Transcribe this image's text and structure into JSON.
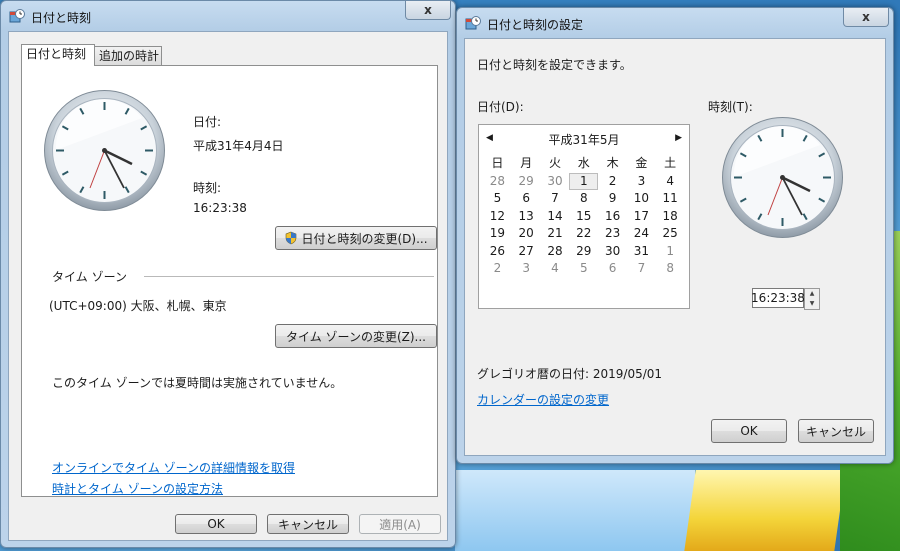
{
  "left_window": {
    "title": "日付と時刻",
    "close_label": "x",
    "tabs": [
      {
        "label": "日付と時刻"
      },
      {
        "label": "追加の時計"
      }
    ],
    "date_label": "日付:",
    "date_value": "平成31年4月4日",
    "time_label": "時刻:",
    "time_value": "16:23:38",
    "change_datetime_button": "日付と時刻の変更(D)...",
    "timezone_header": "タイム ゾーン",
    "timezone_value": "(UTC+09:00) 大阪、札幌、東京",
    "change_timezone_button": "タイム ゾーンの変更(Z)...",
    "dst_message": "このタイム ゾーンでは夏時間は実施されていません。",
    "link_timezone_info": "オンラインでタイム ゾーンの詳細情報を取得",
    "link_clock_settings": "時計とタイム ゾーンの設定方法",
    "ok_button": "OK",
    "cancel_button": "キャンセル",
    "apply_button": "適用(A)"
  },
  "right_window": {
    "title": "日付と時刻の設定",
    "close_label": "x",
    "intro": "日付と時刻を設定できます。",
    "date_label": "日付(D):",
    "time_label": "時刻(T):",
    "calendar": {
      "month_title": "平成31年5月",
      "weekdays": [
        "日",
        "月",
        "火",
        "水",
        "木",
        "金",
        "土"
      ],
      "weeks": [
        [
          "28",
          "29",
          "30",
          "1",
          "2",
          "3",
          "4"
        ],
        [
          "5",
          "6",
          "7",
          "8",
          "9",
          "10",
          "11"
        ],
        [
          "12",
          "13",
          "14",
          "15",
          "16",
          "17",
          "18"
        ],
        [
          "19",
          "20",
          "21",
          "22",
          "23",
          "24",
          "25"
        ],
        [
          "26",
          "27",
          "28",
          "29",
          "30",
          "31",
          "1"
        ],
        [
          "2",
          "3",
          "4",
          "5",
          "6",
          "7",
          "8"
        ]
      ],
      "selected": "1"
    },
    "time_input": "16:23:38",
    "gregorian_label": "グレゴリオ暦の日付: 2019/05/01",
    "link_calendar_settings": "カレンダーの設定の変更",
    "ok_button": "OK",
    "cancel_button": "キャンセル"
  },
  "colors": {
    "link": "#0066cc",
    "accent": "#3d8ac7"
  }
}
